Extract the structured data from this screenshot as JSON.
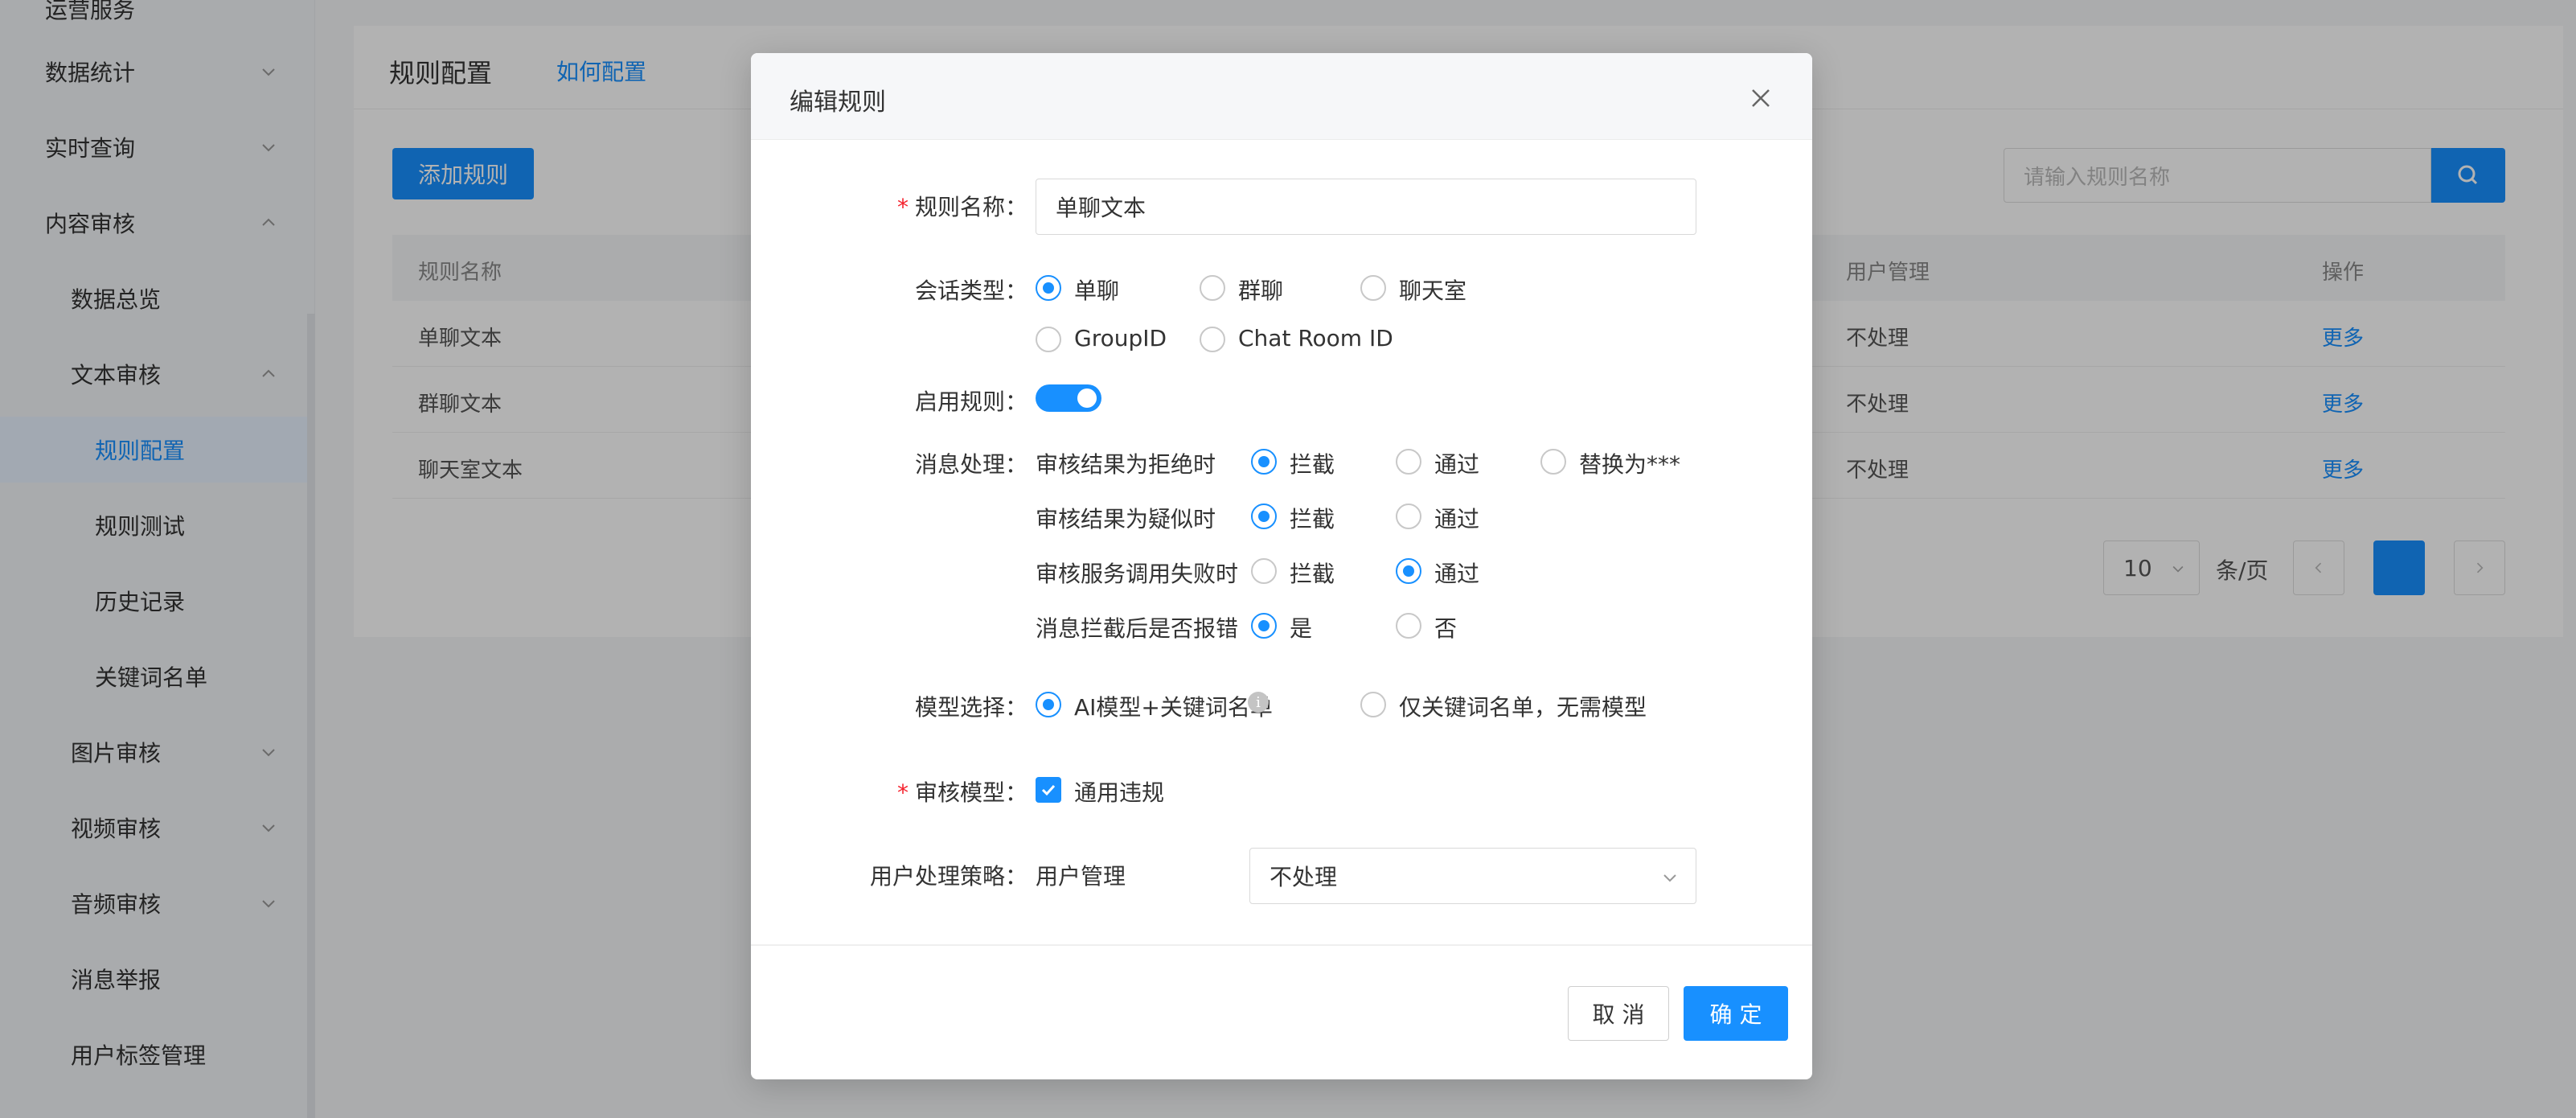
{
  "sidebar": {
    "items": [
      {
        "label": "运营服务",
        "has_arrow": false
      },
      {
        "label": "数据统计",
        "has_arrow": true
      },
      {
        "label": "实时查询",
        "has_arrow": true
      },
      {
        "label": "内容审核",
        "has_arrow": true,
        "expanded": true
      },
      {
        "label": "数据总览",
        "has_arrow": false
      },
      {
        "label": "文本审核",
        "has_arrow": true,
        "expanded": true
      },
      {
        "label": "规则配置",
        "has_arrow": false,
        "active": true
      },
      {
        "label": "规则测试",
        "has_arrow": false
      },
      {
        "label": "历史记录",
        "has_arrow": false
      },
      {
        "label": "关键词名单",
        "has_arrow": false
      },
      {
        "label": "图片审核",
        "has_arrow": true
      },
      {
        "label": "视频审核",
        "has_arrow": true
      },
      {
        "label": "音频审核",
        "has_arrow": true
      },
      {
        "label": "消息举报",
        "has_arrow": false
      },
      {
        "label": "用户标签管理",
        "has_arrow": false
      }
    ]
  },
  "page": {
    "title": "规则配置",
    "help_link": "如何配置",
    "add_button": "添加规则",
    "search_placeholder": "请输入规则名称",
    "table": {
      "headers": [
        "规则名称",
        "用户管理",
        "操作"
      ],
      "rows": [
        {
          "name": "单聊文本",
          "user_mgmt": "不处理",
          "action": "更多"
        },
        {
          "name": "群聊文本",
          "user_mgmt": "不处理",
          "action": "更多"
        },
        {
          "name": "聊天室文本",
          "user_mgmt": "不处理",
          "action": "更多"
        }
      ]
    },
    "pagination": {
      "page_size": "10",
      "unit": "条/页"
    }
  },
  "modal": {
    "title": "编辑规则",
    "fields": {
      "rule_name": {
        "label": "规则名称：",
        "value": "单聊文本",
        "required": true
      },
      "session_type": {
        "label": "会话类型：",
        "options": [
          "单聊",
          "群聊",
          "聊天室",
          "GroupID",
          "Chat Room ID"
        ],
        "selected": "单聊"
      },
      "enable_rule": {
        "label": "启用规则：",
        "on": true
      },
      "message_handling": {
        "label": "消息处理：",
        "rows": [
          {
            "label": "审核结果为拒绝时",
            "options": [
              "拦截",
              "通过",
              "替换为***"
            ],
            "selected": "拦截"
          },
          {
            "label": "审核结果为疑似时",
            "options": [
              "拦截",
              "通过"
            ],
            "selected": "拦截"
          },
          {
            "label": "审核服务调用失败时",
            "options": [
              "拦截",
              "通过"
            ],
            "selected": "通过"
          },
          {
            "label": "消息拦截后是否报错",
            "options": [
              "是",
              "否"
            ],
            "selected": "是"
          }
        ]
      },
      "model_select": {
        "label": "模型选择：",
        "options": [
          "AI模型+关键词名单",
          "仅关键词名单，无需模型"
        ],
        "selected": "AI模型+关键词名单",
        "info_icon": "i"
      },
      "audit_model": {
        "label": "审核模型：",
        "required": true,
        "checkbox_label": "通用违规",
        "checked": true
      },
      "user_policy": {
        "label": "用户处理策略：",
        "sub_label": "用户管理",
        "value": "不处理"
      }
    },
    "buttons": {
      "cancel": "取 消",
      "ok": "确 定"
    }
  },
  "colors": {
    "primary": "#1890ff",
    "required": "#f5222d",
    "overlay": "rgba(0,0,0,0.30)"
  }
}
